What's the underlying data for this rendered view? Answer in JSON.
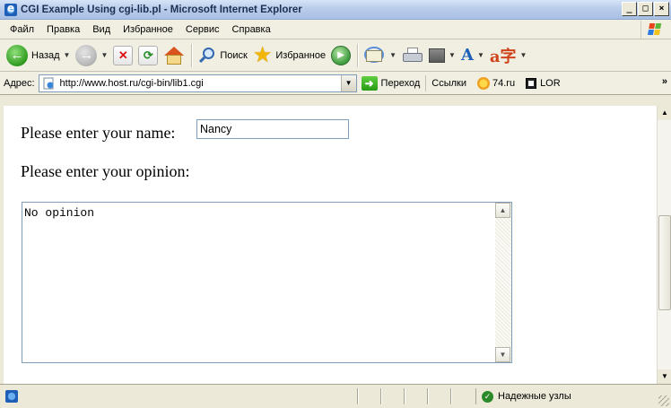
{
  "window": {
    "title": "CGI Example Using cgi-lib.pl - Microsoft Internet Explorer",
    "minimize": "_",
    "maximize": "□",
    "close": "×"
  },
  "menu": {
    "items": [
      "Файл",
      "Правка",
      "Вид",
      "Избранное",
      "Сервис",
      "Справка"
    ]
  },
  "toolbar": {
    "back_label": "Назад",
    "search_label": "Поиск",
    "favorites_label": "Избранное"
  },
  "address": {
    "label": "Адрес:",
    "url": "http://www.host.ru/cgi-bin/lib1.cgi",
    "go_label": "Переход",
    "links_label": "Ссылки",
    "link1": "74.ru",
    "link2": "LOR"
  },
  "form": {
    "name_label": "Please enter your name:",
    "name_value": "Nancy",
    "opinion_label": "Please enter your opinion:",
    "opinion_value": "No opinion"
  },
  "status": {
    "zone": "Надежные узлы"
  },
  "colors": {
    "titlebar": "#b9cdea",
    "chrome": "#ece9d8",
    "field_border": "#7f9db9"
  }
}
